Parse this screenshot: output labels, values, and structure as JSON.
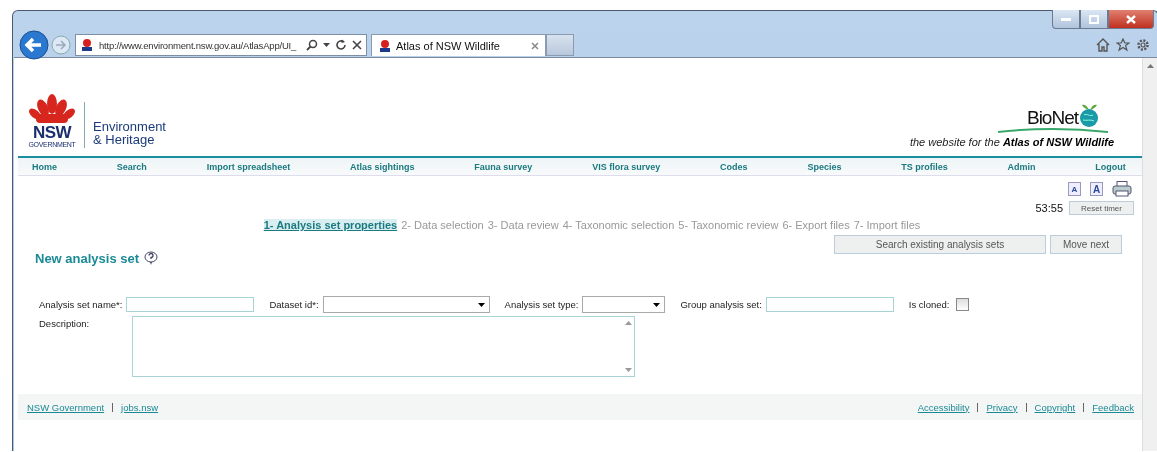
{
  "browser": {
    "address": "http://www.environment.nsw.gov.au/AtlasApp/UI_",
    "tabs": [
      {
        "label": "Atlas of NSW Wildlife",
        "selected": true
      }
    ]
  },
  "header": {
    "logo_text": "NSW",
    "logo_sub": "GOVERNMENT",
    "org_line1": "Environment",
    "org_line2": "& Heritage",
    "brand": "BioNet",
    "tagline": "the website for the **Atlas of NSW Wildlife**"
  },
  "nav": [
    "Home",
    "Search",
    "Import spreadsheet",
    "Atlas sightings",
    "Fauna survey",
    "VIS flora survey",
    "Codes",
    "Species",
    "TS profiles",
    "Admin",
    "Logout"
  ],
  "tools": {
    "font_buttons": [
      "A",
      "A"
    ],
    "timer": "53:55",
    "reset": "Reset timer"
  },
  "steps": [
    {
      "label": "1- Analysis set properties",
      "selected": true
    },
    {
      "label": "2- Data selection",
      "selected": false
    },
    {
      "label": "3- Data review",
      "selected": false
    },
    {
      "label": "4- Taxonomic selection",
      "selected": false
    },
    {
      "label": "5- Taxonomic review",
      "selected": false
    },
    {
      "label": "6- Export files",
      "selected": false
    },
    {
      "label": "7- Import files",
      "selected": false
    }
  ],
  "actions": [
    "Search existing analysis sets",
    "Move next"
  ],
  "heading": "New analysis set",
  "fields": [
    {
      "kind": "text",
      "label": "Analysis set name*:"
    },
    {
      "kind": "select",
      "label": "Dataset id*:"
    },
    {
      "kind": "select",
      "label": "Analysis set type:"
    },
    {
      "kind": "text",
      "label": "Group analysis set:"
    },
    {
      "kind": "checkbox",
      "label": "Is cloned:",
      "checked": false
    }
  ],
  "description": {
    "label": "Description:"
  },
  "footer": {
    "left": [
      "NSW Government",
      "jobs.nsw"
    ],
    "right": [
      "Accessibility",
      "Privacy",
      "Copyright",
      "Feedback"
    ]
  }
}
